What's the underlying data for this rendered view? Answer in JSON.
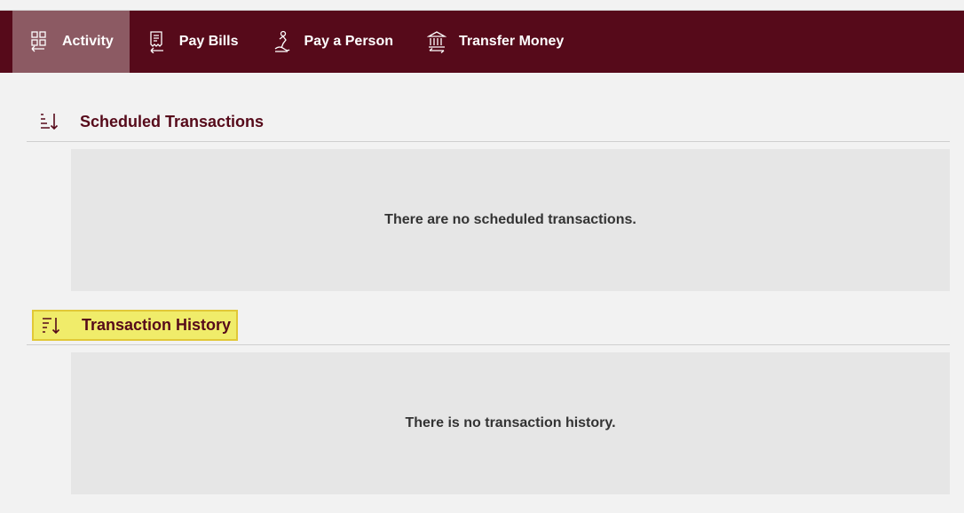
{
  "nav": {
    "tabs": [
      {
        "label": "Activity",
        "icon": "activity-icon",
        "active": true
      },
      {
        "label": "Pay Bills",
        "icon": "bill-icon",
        "active": false
      },
      {
        "label": "Pay a Person",
        "icon": "person-pay-icon",
        "active": false
      },
      {
        "label": "Transfer Money",
        "icon": "bank-icon",
        "active": false
      }
    ]
  },
  "scheduled": {
    "title": "Scheduled Transactions",
    "icon": "sort-ascending-icon",
    "empty_message": "There are no scheduled transactions."
  },
  "history": {
    "title": "Transaction History",
    "icon": "sort-descending-icon",
    "empty_message": "There is no transaction history."
  },
  "colors": {
    "brand": "#560a1a",
    "active_tab": "#8c5a63",
    "highlight": "#f0ec6a",
    "background": "#f2f2f2",
    "panel": "#e6e6e6"
  }
}
